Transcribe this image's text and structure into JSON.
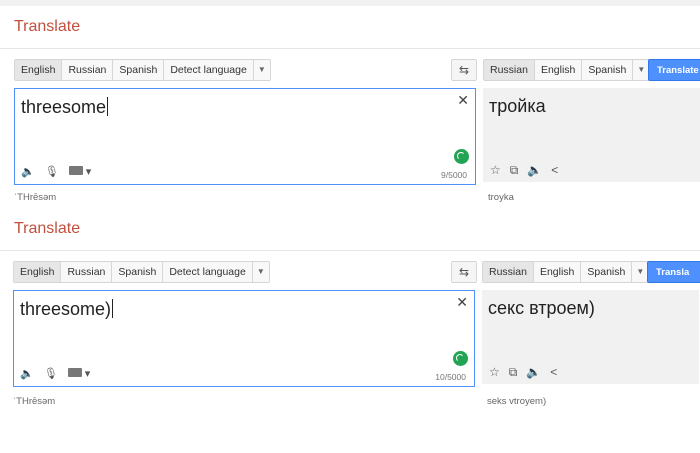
{
  "panels": [
    {
      "title": "Translate",
      "source_langs": [
        "English",
        "Russian",
        "Spanish",
        "Detect language"
      ],
      "target_langs": [
        "Russian",
        "English",
        "Spanish"
      ],
      "translate_label": "Translate",
      "source_text": "threesome",
      "char_count": "9/5000",
      "translation": "тройка",
      "source_translit": "ˈTHrēsəm",
      "target_translit": "troyka"
    },
    {
      "title": "Translate",
      "source_langs": [
        "English",
        "Russian",
        "Spanish",
        "Detect language"
      ],
      "target_langs": [
        "Russian",
        "English",
        "Spanish"
      ],
      "translate_label": "Transla",
      "source_text": "threesome)",
      "char_count": "10/5000",
      "translation": "секс втроем)",
      "source_translit": "ˈTHrēsəm",
      "target_translit": "seks vtroyem)"
    }
  ],
  "icons": {
    "swap": "swap-arrows-icon",
    "clear": "close-icon",
    "speaker": "speaker-icon",
    "mic": "microphone-icon",
    "keyboard": "keyboard-icon",
    "star": "star-icon",
    "copy": "copy-icon",
    "share": "share-icon"
  },
  "colors": {
    "title": "#c1503d",
    "translate_button": "#4d90fe",
    "source_border": "#4d90fe",
    "spinner": "#23a455",
    "target_bg": "#f1f1f1"
  }
}
